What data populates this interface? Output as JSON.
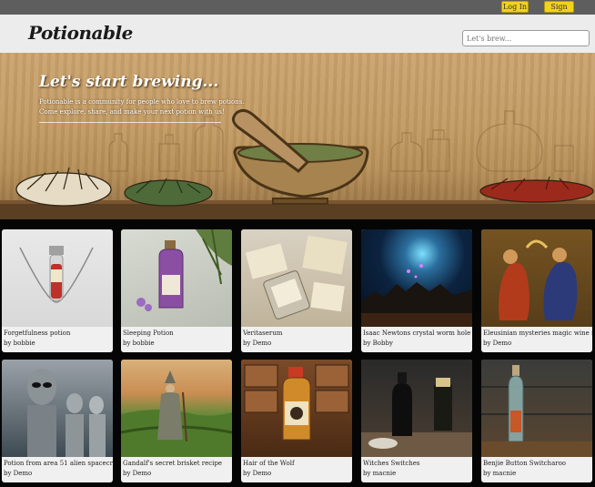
{
  "topbar": {
    "login_label": "Log In",
    "signup_label": "Sign up"
  },
  "header": {
    "logo": "Potionable",
    "search_placeholder": "Let's brew..."
  },
  "hero": {
    "title": "Let's start brewing...",
    "subtitle_line1": "Potionable is a community for people who love to brew potions.",
    "subtitle_line2": "Come explore, share, and make your next potion with us!"
  },
  "potions": [
    {
      "name": "Forgetfulness potion",
      "author": "by bobbie",
      "image": "red-vial-pendant"
    },
    {
      "name": "Sleeping Potion",
      "author": "by bobbie",
      "image": "purple-bottle-flowers"
    },
    {
      "name": "Veritaserum",
      "author": "by Demo",
      "image": "labeled-vials-papers"
    },
    {
      "name": "Isaac Newtons crystal worm hole",
      "author": "by Bobby",
      "image": "glowing-portal"
    },
    {
      "name": "Eleusinian mysteries magic wine recipe",
      "author": "by Demo",
      "image": "ancient-ritual-painting"
    },
    {
      "name": "Potion from area 51 alien spacecraft",
      "author": "by Demo",
      "image": "grey-aliens"
    },
    {
      "name": "Gandalf's secret brisket recipe",
      "author": "by Demo",
      "image": "wizard-in-field"
    },
    {
      "name": "Hair of the Wolf",
      "author": "by Demo",
      "image": "wolf-label-bottle"
    },
    {
      "name": "Witches Switches",
      "author": "by macnie",
      "image": "black-bottle-moon"
    },
    {
      "name": "Benjie Button Switcharoo",
      "author": "by macnie",
      "image": "glass-bottle-wood"
    }
  ]
}
